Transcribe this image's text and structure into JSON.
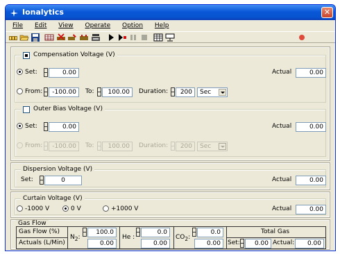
{
  "window": {
    "title": "Ionalytics",
    "close_glyph": "✕"
  },
  "menu": {
    "file": "File",
    "edit": "Edit",
    "view": "View",
    "operate": "Operate",
    "option": "Option",
    "help": "Help"
  },
  "toolbar": {
    "icons": [
      "open-rack-icon",
      "open-folder-icon",
      "save-disk-icon",
      "grid-icon",
      "delete-rack-icon",
      "edit-rack-icon",
      "rack-config-icon",
      "method-icon",
      "run-icon",
      "run-step-icon",
      "pause-icon",
      "stop-icon",
      "table-icon",
      "monitor-icon",
      "record-icon"
    ]
  },
  "compensation": {
    "title": "Compensation Voltage (V)",
    "checked": true,
    "set_label": "Set:",
    "set_value": "0.00",
    "actual_label": "Actual",
    "actual_value": "0.00",
    "from_label": "From:",
    "from_value": "-100.00",
    "to_label": "To:",
    "to_value": "100.00",
    "duration_label": "Duration:",
    "duration_value": "200",
    "unit": "Sec"
  },
  "outer_bias": {
    "title": "Outer Bias Voltage (V)",
    "checked": false,
    "set_label": "Set:",
    "set_value": "0.00",
    "actual_label": "Actual",
    "actual_value": "0.00",
    "from_label": "From:",
    "from_value": "-100.00",
    "to_label": "To:",
    "to_value": "100.00",
    "duration_label": "Duration:",
    "duration_value": "200",
    "unit": "Sec"
  },
  "dispersion": {
    "title": "Dispersion Voltage (V)",
    "set_label": "Set:",
    "set_value": "0",
    "actual_label": "Actual",
    "actual_value": "0.00"
  },
  "curtain": {
    "title": "Curtain Voltage (V)",
    "options": [
      "-1000 V",
      "0 V",
      "+1000 V"
    ],
    "selected": "0 V",
    "actual_label": "Actual",
    "actual_value": "0.00"
  },
  "gas_flow": {
    "title": "Gas Flow",
    "flow_label": "Gas Flow (%)",
    "actuals_label": "Actuals (L/Min)",
    "n2_label": "N",
    "n2_sub": "2",
    "n2_suffix": ":",
    "n2_set": "100.0",
    "n2_actual": "0.00",
    "he_label": "He :",
    "he_set": "0.0",
    "he_actual": "0.00",
    "co2_label": "CO",
    "co2_sub": "2",
    "co2_suffix": ":",
    "co2_set": "0.0",
    "co2_actual": "0.00",
    "total_label": "Total Gas",
    "total_set_label": "Set:",
    "total_set": "0.00",
    "total_actual_label": "Actual:",
    "total_actual": "0.00"
  },
  "colors": {
    "title_bar": "#0a58d8",
    "window_bg": "#ece9d8",
    "close": "#c8452c",
    "record": "#e04a3a"
  }
}
